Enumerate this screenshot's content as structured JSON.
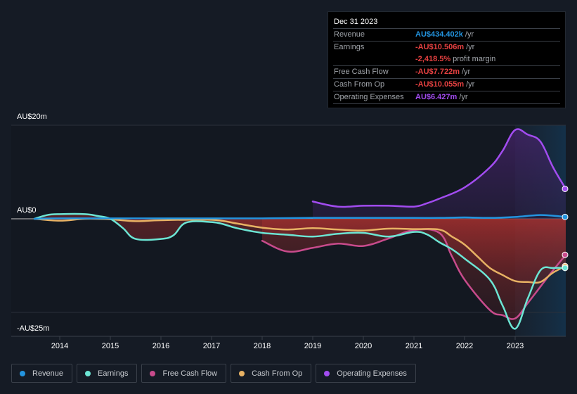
{
  "tooltip": {
    "date": "Dec 31 2023",
    "rows": [
      {
        "label": "Revenue",
        "value": "AU$434.402k",
        "unit": "/yr",
        "color": "#2394df"
      },
      {
        "label": "Earnings",
        "value": "-AU$10.506m",
        "unit": "/yr",
        "color": "#e64141"
      },
      {
        "label": "",
        "value": "-2,418.5%",
        "unit": "profit margin",
        "color": "#e64141"
      },
      {
        "label": "Free Cash Flow",
        "value": "-AU$7.722m",
        "unit": "/yr",
        "color": "#e64141"
      },
      {
        "label": "Cash From Op",
        "value": "-AU$10.055m",
        "unit": "/yr",
        "color": "#e64141"
      },
      {
        "label": "Operating Expenses",
        "value": "AU$6.427m",
        "unit": "/yr",
        "color": "#a24cf0"
      }
    ]
  },
  "legend": [
    {
      "label": "Revenue",
      "color": "#2394df"
    },
    {
      "label": "Earnings",
      "color": "#6ce5d4"
    },
    {
      "label": "Free Cash Flow",
      "color": "#c84b8c"
    },
    {
      "label": "Cash From Op",
      "color": "#e8b264"
    },
    {
      "label": "Operating Expenses",
      "color": "#a24cf0"
    }
  ],
  "chart_data": {
    "type": "line",
    "title": "",
    "xlabel": "",
    "ylabel": "",
    "y_tick_labels": [
      {
        "value": 20,
        "label": "AU$20m"
      },
      {
        "value": 0,
        "label": "AU$0"
      },
      {
        "value": -25,
        "label": "-AU$25m"
      }
    ],
    "ylim": [
      -25,
      20
    ],
    "y_gridlines": [
      20,
      0,
      -20
    ],
    "xlim": [
      2013.25,
      2024.0
    ],
    "x_ticks": [
      2014,
      2015,
      2016,
      2017,
      2018,
      2019,
      2020,
      2021,
      2022,
      2023
    ],
    "forecast_shade_start": 2023.0,
    "legend_position": "bottom-left",
    "series": [
      {
        "name": "Revenue",
        "color": "#2394df",
        "points": [
          [
            2013.5,
            0.0
          ],
          [
            2014.0,
            0.1
          ],
          [
            2015.0,
            0.1
          ],
          [
            2016.0,
            0.1
          ],
          [
            2017.0,
            0.1
          ],
          [
            2018.0,
            0.1
          ],
          [
            2019.0,
            0.2
          ],
          [
            2020.0,
            0.2
          ],
          [
            2021.0,
            0.2
          ],
          [
            2021.5,
            0.2
          ],
          [
            2022.0,
            0.3
          ],
          [
            2022.5,
            0.2
          ],
          [
            2023.0,
            0.4
          ],
          [
            2023.5,
            0.8
          ],
          [
            2024.0,
            0.4
          ]
        ]
      },
      {
        "name": "Earnings",
        "color": "#6ce5d4",
        "points": [
          [
            2013.5,
            0.0
          ],
          [
            2013.75,
            0.8
          ],
          [
            2014.0,
            1.0
          ],
          [
            2014.5,
            1.0
          ],
          [
            2014.75,
            0.6
          ],
          [
            2015.0,
            0.0
          ],
          [
            2015.25,
            -2.0
          ],
          [
            2015.5,
            -4.3
          ],
          [
            2016.0,
            -4.3
          ],
          [
            2016.25,
            -3.5
          ],
          [
            2016.5,
            -0.8
          ],
          [
            2017.0,
            -0.7
          ],
          [
            2017.25,
            -1.2
          ],
          [
            2017.5,
            -2.0
          ],
          [
            2018.0,
            -3.0
          ],
          [
            2018.5,
            -3.4
          ],
          [
            2019.0,
            -3.8
          ],
          [
            2019.5,
            -3.2
          ],
          [
            2020.0,
            -3.0
          ],
          [
            2020.5,
            -3.8
          ],
          [
            2021.0,
            -2.8
          ],
          [
            2021.25,
            -3.3
          ],
          [
            2021.5,
            -5.0
          ],
          [
            2021.75,
            -6.5
          ],
          [
            2022.0,
            -8.5
          ],
          [
            2022.5,
            -13.0
          ],
          [
            2022.75,
            -18.5
          ],
          [
            2023.0,
            -23.5
          ],
          [
            2023.25,
            -17.0
          ],
          [
            2023.5,
            -11.0
          ],
          [
            2023.75,
            -10.5
          ],
          [
            2024.0,
            -10.5
          ]
        ]
      },
      {
        "name": "Free Cash Flow",
        "color": "#c84b8c",
        "points": [
          [
            2018.0,
            -4.7
          ],
          [
            2018.5,
            -7.0
          ],
          [
            2019.0,
            -6.2
          ],
          [
            2019.5,
            -5.3
          ],
          [
            2020.0,
            -5.8
          ],
          [
            2020.5,
            -4.2
          ],
          [
            2021.0,
            -2.4
          ],
          [
            2021.5,
            -3.0
          ],
          [
            2021.75,
            -8.0
          ],
          [
            2022.0,
            -13.0
          ],
          [
            2022.5,
            -19.5
          ],
          [
            2022.75,
            -20.6
          ],
          [
            2023.0,
            -21.3
          ],
          [
            2023.25,
            -18.0
          ],
          [
            2023.5,
            -14.5
          ],
          [
            2023.75,
            -11.0
          ],
          [
            2024.0,
            -7.7
          ]
        ]
      },
      {
        "name": "Cash From Op",
        "color": "#e8b264",
        "points": [
          [
            2013.5,
            0.0
          ],
          [
            2014.0,
            -0.4
          ],
          [
            2014.5,
            0.0
          ],
          [
            2015.0,
            -0.1
          ],
          [
            2015.5,
            -0.5
          ],
          [
            2016.0,
            -0.3
          ],
          [
            2017.0,
            -0.2
          ],
          [
            2017.5,
            -1.0
          ],
          [
            2018.0,
            -1.9
          ],
          [
            2018.5,
            -2.3
          ],
          [
            2019.0,
            -2.0
          ],
          [
            2019.5,
            -2.3
          ],
          [
            2020.0,
            -2.5
          ],
          [
            2020.5,
            -2.1
          ],
          [
            2021.0,
            -2.2
          ],
          [
            2021.5,
            -2.3
          ],
          [
            2021.75,
            -3.8
          ],
          [
            2022.0,
            -5.5
          ],
          [
            2022.25,
            -8.0
          ],
          [
            2022.5,
            -10.5
          ],
          [
            2022.75,
            -12.0
          ],
          [
            2023.0,
            -13.3
          ],
          [
            2023.25,
            -13.5
          ],
          [
            2023.5,
            -13.5
          ],
          [
            2023.75,
            -11.5
          ],
          [
            2024.0,
            -10.1
          ]
        ]
      },
      {
        "name": "Operating Expenses",
        "color": "#a24cf0",
        "points": [
          [
            2019.0,
            3.7
          ],
          [
            2019.5,
            2.6
          ],
          [
            2020.0,
            2.8
          ],
          [
            2020.5,
            2.8
          ],
          [
            2021.0,
            2.6
          ],
          [
            2021.25,
            3.3
          ],
          [
            2021.5,
            4.3
          ],
          [
            2022.0,
            6.7
          ],
          [
            2022.5,
            11.0
          ],
          [
            2022.75,
            14.5
          ],
          [
            2023.0,
            19.0
          ],
          [
            2023.25,
            18.0
          ],
          [
            2023.5,
            16.5
          ],
          [
            2023.75,
            11.0
          ],
          [
            2024.0,
            6.4
          ]
        ]
      }
    ]
  }
}
